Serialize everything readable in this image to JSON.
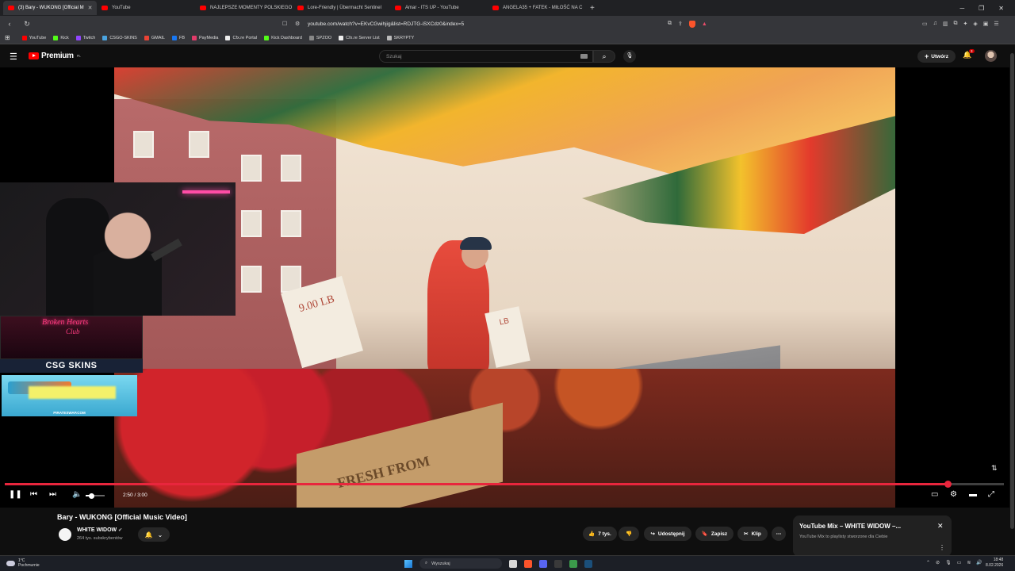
{
  "browser": {
    "tabs": [
      {
        "label": "(3) Bary - WUKONG [Official M",
        "active": true
      },
      {
        "label": "YouTube",
        "active": false
      },
      {
        "label": "NAJLEPSZE MOMENTY POLSKIEGO",
        "active": false
      },
      {
        "label": "Lore-Friendly | Übermacht Sentinel",
        "active": false
      },
      {
        "label": "Amar - ITS UP - YouTube",
        "active": false
      },
      {
        "label": "ANGELA35 + FATEK - MIŁOŚĆ NA C",
        "active": false
      }
    ],
    "new_tab": "+",
    "url": "youtube.com/watch?v=EKvCGwihjig&list=RDJTG-iSXCdz0&index=5",
    "bookmarks": [
      {
        "label": "YouTube",
        "color": "#ff0000"
      },
      {
        "label": "Kick",
        "color": "#53fc18"
      },
      {
        "label": "Twitch",
        "color": "#9146ff"
      },
      {
        "label": "CSGO-SKINS",
        "color": "#4aa3df"
      },
      {
        "label": "GMAIL",
        "color": "#ea4335"
      },
      {
        "label": "FB",
        "color": "#1877f2"
      },
      {
        "label": "PayMedia",
        "color": "#e23b6a"
      },
      {
        "label": "Cfx.re Portal",
        "color": "#eeeeee"
      },
      {
        "label": "Kick Dashboard",
        "color": "#53fc18"
      },
      {
        "label": "SPZOO",
        "color": "#888888"
      },
      {
        "label": "Cfx.re Server List",
        "color": "#eeeeee"
      },
      {
        "label": "SKRYPTY",
        "color": "#bbbbbb"
      }
    ]
  },
  "youtube": {
    "logo_text": "Premium",
    "region": "PL",
    "search_placeholder": "Szukaj",
    "create_label": "Utwórz",
    "notif_count": "3"
  },
  "overlay": {
    "brand_title": "Broken Hearts",
    "brand_sub": "Club",
    "sponsor": "CSG SKINS",
    "promo": "PIRATESWAP.COM"
  },
  "player": {
    "time": "2:50 / 3:00",
    "progress": 0.944
  },
  "video_text": {
    "sign1": "9.00 LB",
    "sign2": "LB",
    "crate": "FRESH FROM"
  },
  "video": {
    "title": "Bary - WUKONG [Official Music Video]",
    "channel": "WHITE WIDOW",
    "subs": "264 tys. subskrybentów",
    "likes": "7 tys.",
    "share": "Udostępnij",
    "save": "Zapisz",
    "clip": "Klip"
  },
  "mix": {
    "title": "YouTube Mix – WHITE WIDOW –...",
    "subtitle": "YouTube Mix to playlisty stworzone dla Ciebie"
  },
  "taskbar": {
    "temp": "1°C",
    "weather": "Pochmurnie",
    "search": "Wyszukaj",
    "time": "18:48",
    "date": "8.02.2026"
  }
}
